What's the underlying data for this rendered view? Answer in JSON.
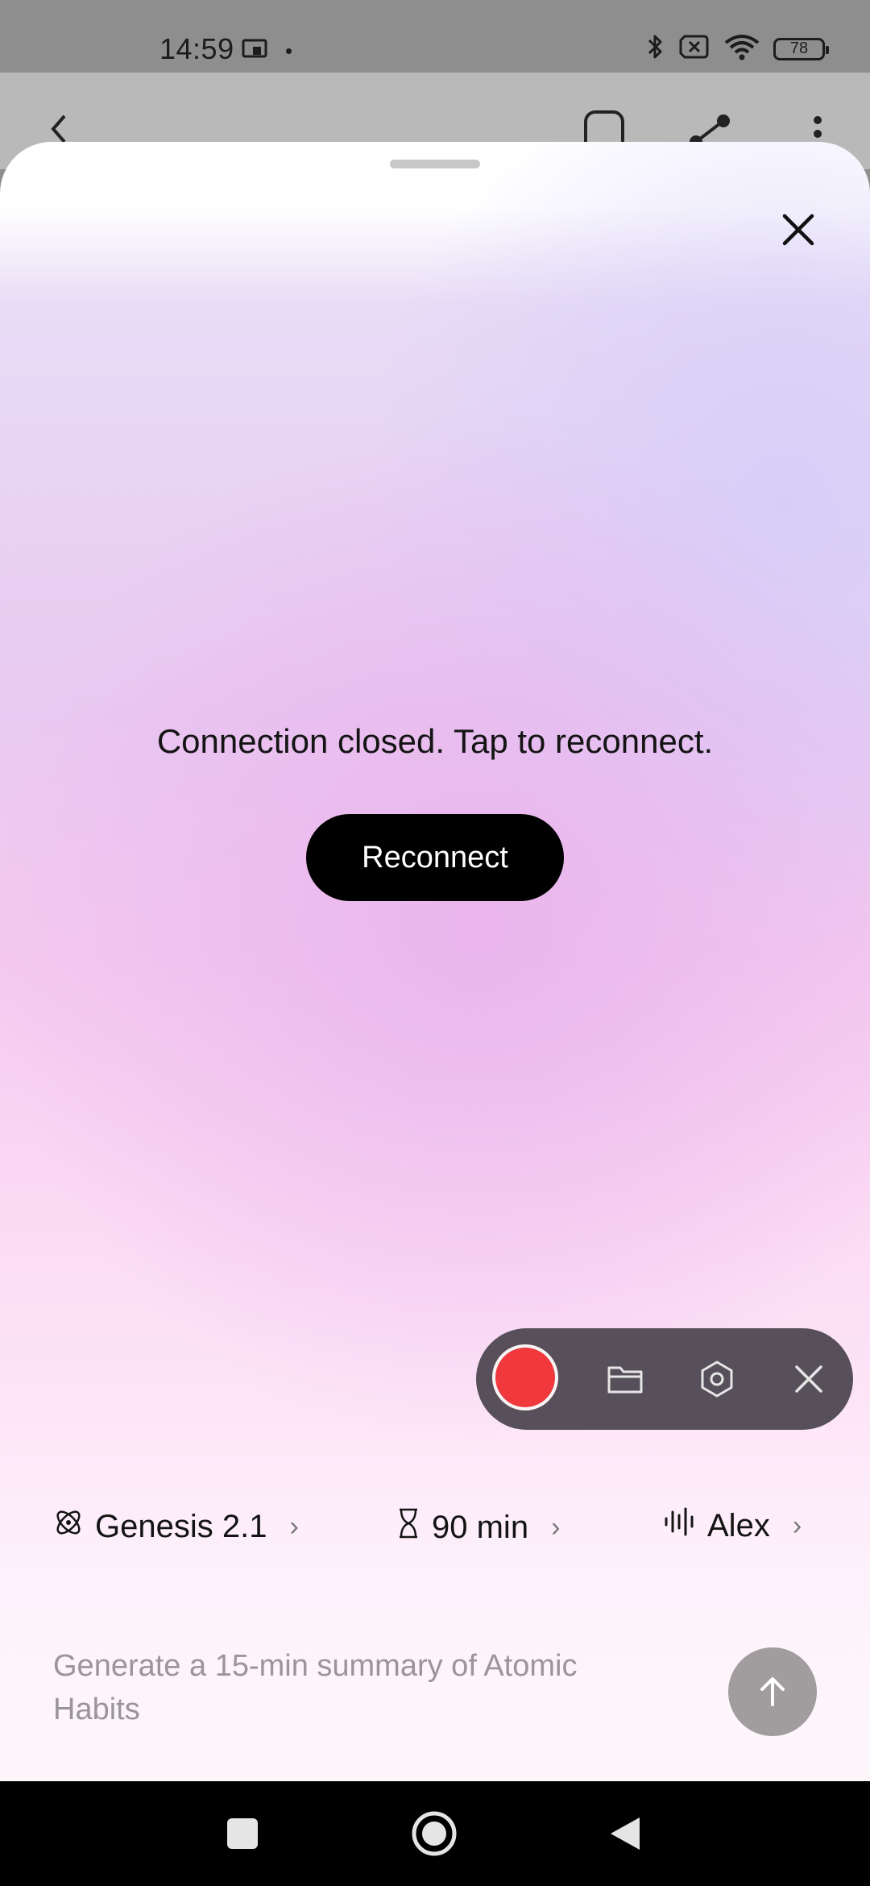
{
  "status_bar": {
    "time": "14:59",
    "dot": "•",
    "battery": "78",
    "icons": [
      "cast-icon",
      "bluetooth-icon",
      "sim-off-icon",
      "wifi-icon",
      "battery-icon"
    ]
  },
  "background_app": {
    "icons": [
      "back-icon",
      "bookmark-icon",
      "share-icon",
      "more-icon"
    ]
  },
  "sheet": {
    "message": "Connection closed. Tap to reconnect.",
    "reconnect_label": "Reconnect"
  },
  "recorder": {
    "icons": [
      "record-icon",
      "folder-icon",
      "settings-icon",
      "close-icon"
    ],
    "record_color": "#f0383d"
  },
  "options": {
    "model": "Genesis 2.1",
    "duration": "90 min",
    "voice": "Alex"
  },
  "input": {
    "prompt": "Generate a 15-min summary of Atomic Habits"
  },
  "nav": {
    "icons": [
      "recents-icon",
      "home-icon",
      "back-nav-icon"
    ]
  }
}
